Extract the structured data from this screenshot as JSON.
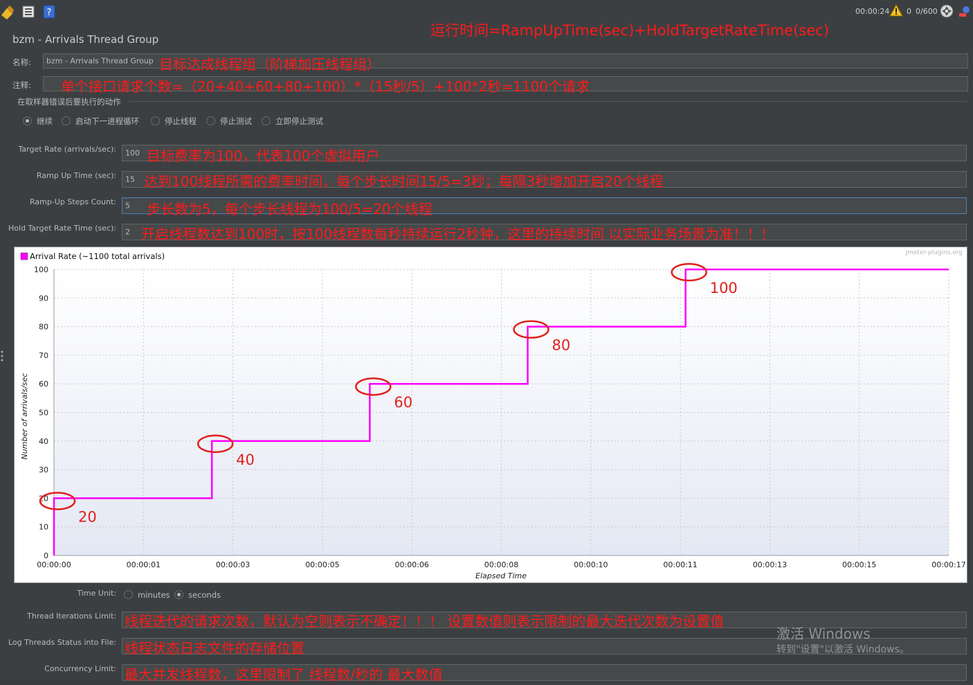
{
  "toolbar": {
    "icons": [
      "broom-icon",
      "list-icon",
      "help-icon"
    ],
    "timer": "00:00:24",
    "warning_count": "0",
    "threads": "0/600"
  },
  "annotations": {
    "runtime_formula": "运行时间=RampUpTime(sec)+HoldTargetRateTime(sec)",
    "name_note": "目标达成线程组（阶梯加压线程组）",
    "comment_note": "单个接口请求个数=（20+40+60+80+100）*（15秒/5）+100*2秒=1100个请求",
    "target_rate_note": "目标费率为100，代表100个虚拟用户",
    "ramp_up_note": "达到100线程所需的费率时间，每个步长时间15/5=3秒；每隔3秒增加开启20个线程",
    "steps_note": "步长数为5，每个步长线程为100/5=20个线程",
    "hold_note": "开启线程数达到100时，按100线程数每秒持续运行2秒钟，这里的持续时间 以实际业务场景为准！！！",
    "iterations_note": "线程迭代的请求次数，默认为空则表示不确定！！！ 设置数值则表示限制的最大迭代次数为设置值",
    "log_note": "线程状态日志文件的存储位置",
    "concurrency_note": "最大并发线程数，这里限制了 线程数/秒的 最大数值",
    "step_labels": [
      "20",
      "40",
      "60",
      "80",
      "100"
    ]
  },
  "panel": {
    "title": "bzm - Arrivals Thread Group",
    "name_label": "名称:",
    "name_value": "bzm - Arrivals Thread Group",
    "comment_label": "注释:",
    "error_section_label": "在取样器错误后要执行的动作",
    "error_actions": [
      {
        "label": "继续",
        "checked": true
      },
      {
        "label": "启动下一进程循环",
        "checked": false
      },
      {
        "label": "停止线程",
        "checked": false
      },
      {
        "label": "停止测试",
        "checked": false
      },
      {
        "label": "立即停止测试",
        "checked": false
      }
    ],
    "target_rate_label": "Target Rate (arrivals/sec):",
    "target_rate_value": "100",
    "ramp_up_label": "Ramp Up Time (sec):",
    "ramp_up_value": "15",
    "steps_label": "Ramp-Up Steps Count:",
    "steps_value": "5",
    "hold_label": "Hold Target Rate Time (sec):",
    "hold_value": "2",
    "time_unit_label": "Time Unit:",
    "time_unit_minutes": "minutes",
    "time_unit_seconds": "seconds",
    "time_unit_selected": "seconds",
    "iterations_label": "Thread Iterations Limit:",
    "log_label": "Log Threads Status into File:",
    "concurrency_label": "Concurrency Limit:"
  },
  "watermark": {
    "line1": "激活 Windows",
    "line2": "转到\"设置\"以激活 Windows。"
  },
  "chart_data": {
    "type": "line",
    "watermark": "jmeter-plugins.org",
    "legend": "Arrival Rate (~1100 total arrivals)",
    "legend_color": "#ff00ff",
    "legend_position": "top-left",
    "xlabel": "Elapsed Time",
    "ylabel": "Number of arrivals/sec",
    "ylim": [
      0,
      100
    ],
    "yticks": [
      0,
      10,
      20,
      30,
      40,
      50,
      60,
      70,
      80,
      90,
      100
    ],
    "xlim_sec": [
      0,
      17
    ],
    "xticks": [
      "00:00:00",
      "00:00:01",
      "00:00:03",
      "00:00:05",
      "00:00:06",
      "00:00:08",
      "00:00:10",
      "00:00:11",
      "00:00:13",
      "00:00:15",
      "00:00:17"
    ],
    "xtick_secs": [
      0,
      1.7,
      3.4,
      5.1,
      6.8,
      8.5,
      10.2,
      11.9,
      13.6,
      15.3,
      17
    ],
    "grid": true,
    "series": [
      {
        "name": "Arrival Rate (~1100 total arrivals)",
        "color": "#ff00ff",
        "points": [
          [
            0,
            0
          ],
          [
            0,
            20
          ],
          [
            3,
            20
          ],
          [
            3,
            40
          ],
          [
            6,
            40
          ],
          [
            6,
            60
          ],
          [
            9,
            60
          ],
          [
            9,
            80
          ],
          [
            12,
            80
          ],
          [
            12,
            100
          ],
          [
            17,
            100
          ]
        ]
      }
    ]
  }
}
